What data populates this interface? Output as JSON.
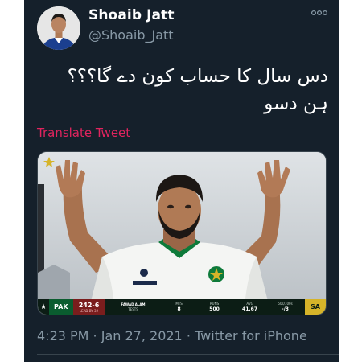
{
  "tweet": {
    "author": {
      "display_name": "Shoaib Jatt",
      "handle": "@Shoaib_Jatt"
    },
    "text_lines": [
      "دس سال کا حساب کون دے گا؟؟؟",
      "ہن دسو"
    ],
    "translate_label": "Translate Tweet",
    "timestamp": "4:23 PM · Jan 27, 2021 · Twitter for iPhone",
    "more_icon": "more-horizontal-icon"
  },
  "media": {
    "scorebar": {
      "team": "PAK",
      "score": "242-6",
      "score_sub": "LEAD BY 32",
      "player_label": "FAWAD ALAM",
      "player_sub": "TESTS",
      "mts_label": "MTS",
      "mts_value": "8",
      "runs_label": "RUNS",
      "runs_value": "500",
      "avg_label": "AVG",
      "avg_value": "41.67",
      "fifties_label": "50s/100s",
      "fifties_value": "-/3",
      "opponent": "SA"
    }
  },
  "colors": {
    "background": "#15202b",
    "text_primary": "#ffffff",
    "text_secondary": "#8899a6",
    "translate_link": "#e0245e"
  }
}
